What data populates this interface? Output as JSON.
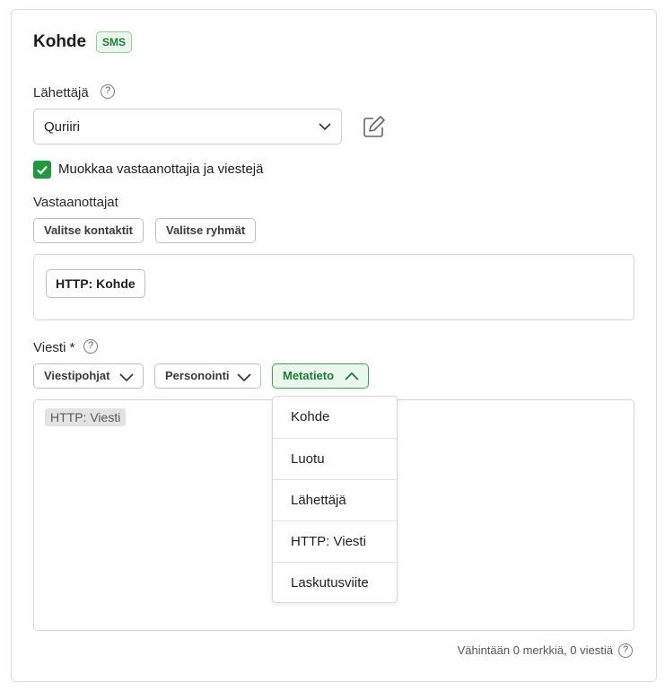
{
  "header": {
    "title": "Kohde",
    "badge": "SMS"
  },
  "sender": {
    "label": "Lähettäjä",
    "value": "Quriiri"
  },
  "edit_checkbox": {
    "label": "Muokkaa vastaanottajia ja viestejä",
    "checked": true
  },
  "recipients": {
    "label": "Vastaanottajat",
    "buttons": [
      "Valitse kontaktit",
      "Valitse ryhmät"
    ],
    "chips": [
      "HTTP: Kohde"
    ]
  },
  "message": {
    "label": "Viesti *",
    "dropdowns": [
      {
        "label": "Viestipohjat",
        "open": false
      },
      {
        "label": "Personointi",
        "open": false
      },
      {
        "label": "Metatieto",
        "open": true
      }
    ],
    "content_tag": "HTTP: Viesti",
    "menu_items": [
      "Kohde",
      "Luotu",
      "Lähettäjä",
      "HTTP: Viesti",
      "Laskutusviite"
    ],
    "counter": "Vähintään 0 merkkiä, 0 viestiä"
  },
  "colors": {
    "accent": "#1e9a3c",
    "accent_bg": "#eaf7ec",
    "border": "#d6d6d6"
  }
}
